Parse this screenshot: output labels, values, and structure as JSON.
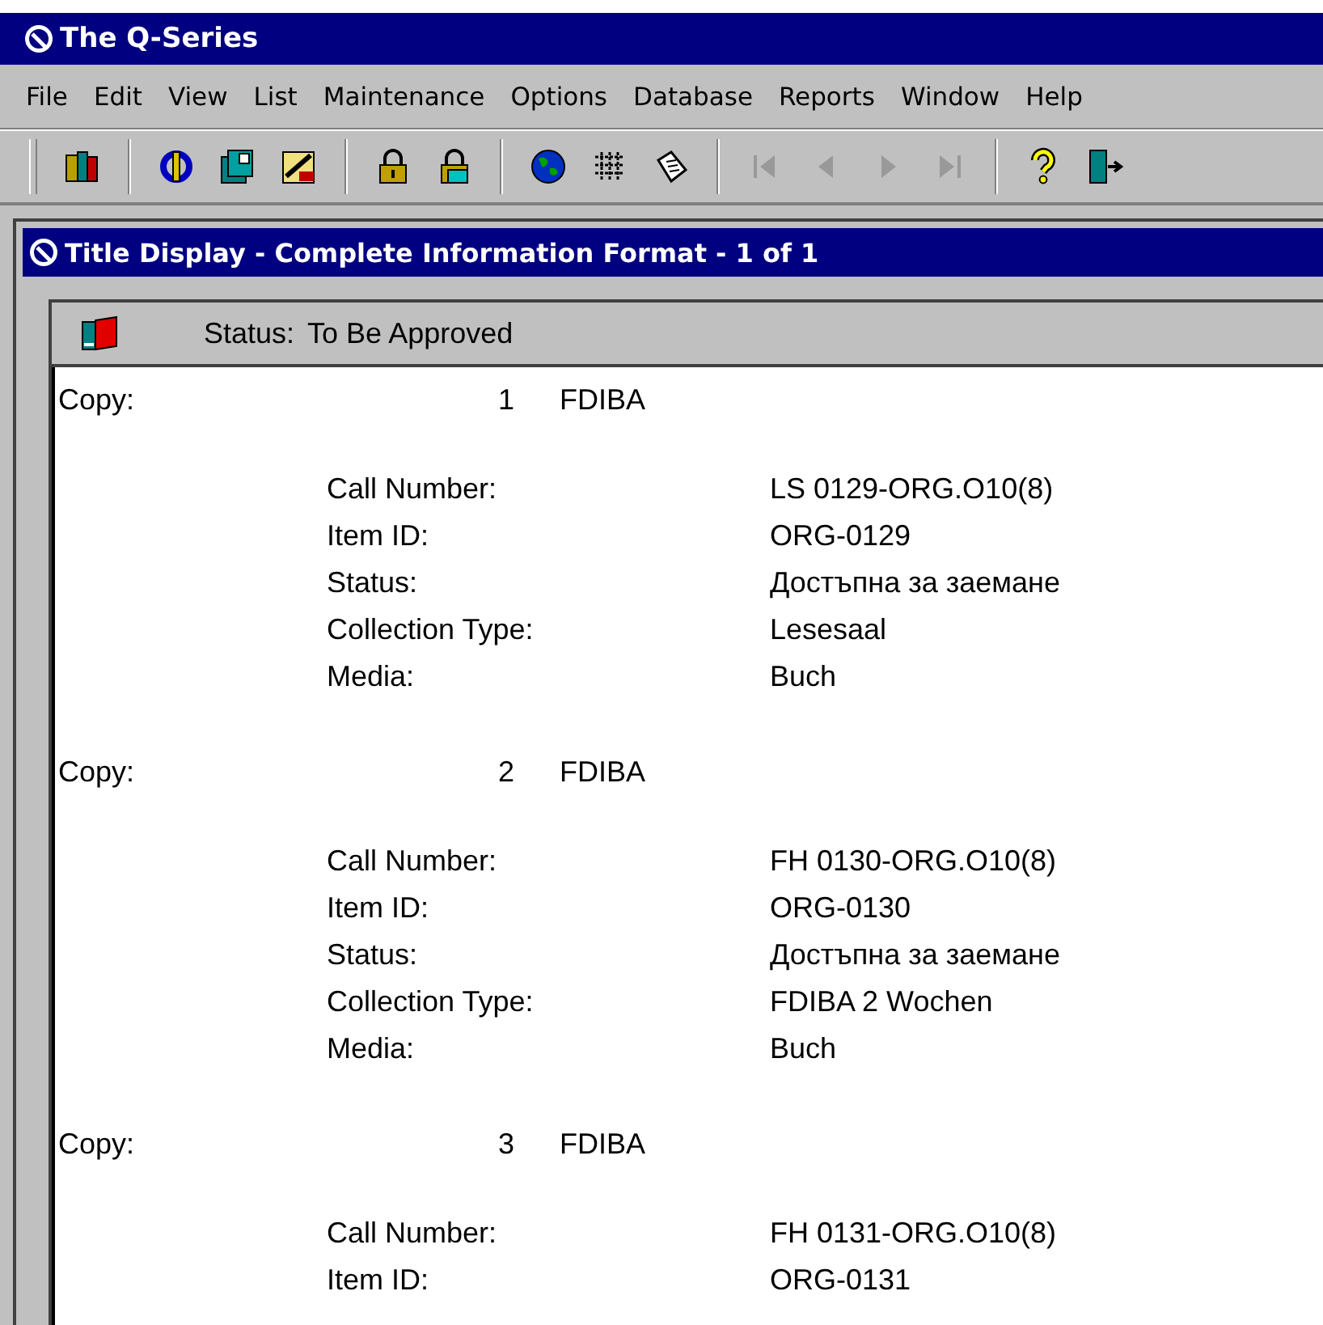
{
  "window": {
    "title": "The Q-Series"
  },
  "menu": [
    "File",
    "Edit",
    "View",
    "List",
    "Maintenance",
    "Options",
    "Database",
    "Reports",
    "Window",
    "Help"
  ],
  "toolbar": [
    {
      "kind": "books",
      "disabled": false
    },
    {
      "kind": "separator"
    },
    {
      "kind": "sync",
      "disabled": false
    },
    {
      "kind": "pages",
      "disabled": false
    },
    {
      "kind": "edit-note",
      "disabled": false
    },
    {
      "kind": "separator"
    },
    {
      "kind": "lock",
      "disabled": false
    },
    {
      "kind": "unlock",
      "disabled": false
    },
    {
      "kind": "separator"
    },
    {
      "kind": "globe",
      "disabled": false
    },
    {
      "kind": "grid",
      "disabled": false
    },
    {
      "kind": "note",
      "disabled": false
    },
    {
      "kind": "separator"
    },
    {
      "kind": "first",
      "disabled": true
    },
    {
      "kind": "prev",
      "disabled": true
    },
    {
      "kind": "next",
      "disabled": true
    },
    {
      "kind": "last",
      "disabled": true
    },
    {
      "kind": "separator"
    },
    {
      "kind": "help",
      "disabled": false
    },
    {
      "kind": "exit",
      "disabled": false
    }
  ],
  "child_window": {
    "title": "Title Display - Complete Information Format -  1 of 1",
    "status_label": "Status:",
    "status_value": "To Be Approved",
    "copies": [
      {
        "label": "Copy:",
        "number": "1",
        "location": "FDIBA",
        "fields": [
          {
            "label": "Call Number:",
            "value": "LS 0129-ORG.O10(8)"
          },
          {
            "label": "Item ID:",
            "value": "ORG-0129"
          },
          {
            "label": "Status:",
            "value": "Достъпна за заемане"
          },
          {
            "label": "Collection Type:",
            "value": "Lesesaal"
          },
          {
            "label": "Media:",
            "value": "Buch"
          }
        ]
      },
      {
        "label": "Copy:",
        "number": "2",
        "location": "FDIBA",
        "fields": [
          {
            "label": "Call Number:",
            "value": "FH 0130-ORG.O10(8)"
          },
          {
            "label": "Item ID:",
            "value": "ORG-0130"
          },
          {
            "label": "Status:",
            "value": "Достъпна за заемане"
          },
          {
            "label": "Collection Type:",
            "value": "FDIBA 2 Wochen"
          },
          {
            "label": "Media:",
            "value": "Buch"
          }
        ]
      },
      {
        "label": "Copy:",
        "number": "3",
        "location": "FDIBA",
        "fields": [
          {
            "label": "Call Number:",
            "value": "FH 0131-ORG.O10(8)"
          },
          {
            "label": "Item ID:",
            "value": "ORG-0131"
          }
        ]
      }
    ]
  }
}
